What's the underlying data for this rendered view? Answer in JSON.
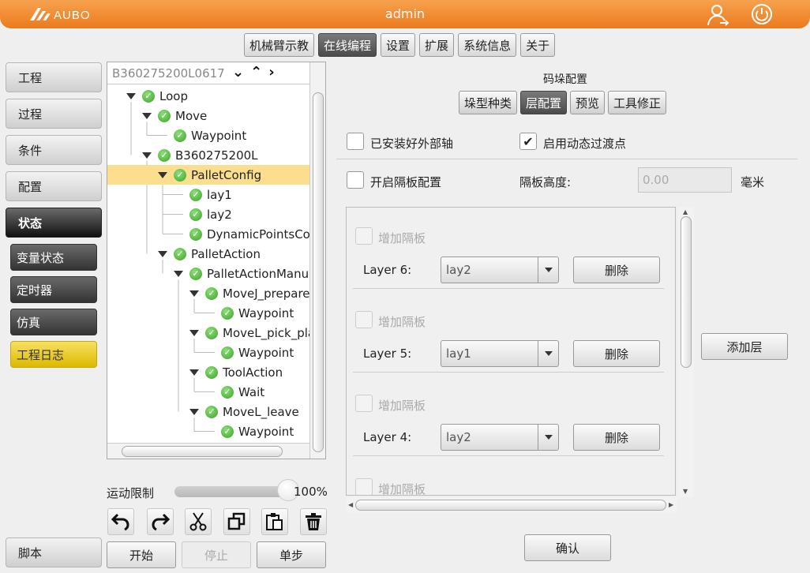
{
  "header": {
    "logo_text": "AUBO",
    "title": "admin",
    "user_icon": "user-logout-icon",
    "power_icon": "power-icon"
  },
  "top_tabs": [
    {
      "label": "机械臂示教",
      "active": false
    },
    {
      "label": "在线编程",
      "active": true
    },
    {
      "label": "设置",
      "active": false
    },
    {
      "label": "扩展",
      "active": false
    },
    {
      "label": "系统信息",
      "active": false
    },
    {
      "label": "关于",
      "active": false
    }
  ],
  "nav": {
    "project": "工程",
    "process": "过程",
    "condition": "条件",
    "config": "配置",
    "status": "状态",
    "var_status": "变量状态",
    "timer": "定时器",
    "simulation": "仿真",
    "project_log": "工程日志",
    "script": "脚本"
  },
  "tree": {
    "header_text": "B360275200L0617",
    "nodes": [
      {
        "label": "Loop",
        "level": 0,
        "expanded": true
      },
      {
        "label": "Move",
        "level": 1,
        "expanded": true
      },
      {
        "label": "Waypoint",
        "level": 2
      },
      {
        "label": "B360275200L",
        "level": 1,
        "expanded": true
      },
      {
        "label": "PalletConfig",
        "level": 2,
        "expanded": true,
        "selected": true
      },
      {
        "label": "lay1",
        "level": 3
      },
      {
        "label": "lay2",
        "level": 3
      },
      {
        "label": "DynamicPointsCon",
        "level": 3
      },
      {
        "label": "PalletAction",
        "level": 2,
        "expanded": true
      },
      {
        "label": "PalletActionManua",
        "level": 3,
        "expanded": true
      },
      {
        "label": "MoveJ_prepare",
        "level": 4,
        "expanded": true
      },
      {
        "label": "Waypoint",
        "level": 5
      },
      {
        "label": "MoveL_pick_pla",
        "level": 4,
        "expanded": true
      },
      {
        "label": "Waypoint",
        "level": 5
      },
      {
        "label": "ToolAction",
        "level": 4,
        "expanded": true
      },
      {
        "label": "Wait",
        "level": 5
      },
      {
        "label": "MoveL_leave",
        "level": 4,
        "expanded": true
      },
      {
        "label": "Waypoint",
        "level": 5
      }
    ]
  },
  "motion": {
    "label": "运动限制",
    "value_text": "100%",
    "fraction": 1.0
  },
  "run": {
    "start": "开始",
    "stop": "停止",
    "step": "单步"
  },
  "pallet": {
    "title": "码垛配置",
    "subtabs": [
      {
        "label": "垛型种类",
        "active": false
      },
      {
        "label": "层配置",
        "active": true
      },
      {
        "label": "预览",
        "active": false
      },
      {
        "label": "工具修正",
        "active": false
      }
    ],
    "external_axis_label": "已安装好外部轴",
    "external_axis_checked": false,
    "dynamic_transition_label": "启用动态过渡点",
    "dynamic_transition_checked": true,
    "partition_label": "开启隔板配置",
    "partition_checked": false,
    "partition_height_label": "隔板高度:",
    "partition_height_value": "0.00",
    "unit": "毫米",
    "add_partition_label": "增加隔板",
    "delete_label": "删除",
    "layers": [
      {
        "label": "Layer 6:",
        "value": "lay2"
      },
      {
        "label": "Layer 5:",
        "value": "lay1"
      },
      {
        "label": "Layer 4:",
        "value": "lay2"
      }
    ],
    "add_layer": "添加层",
    "confirm": "确认"
  }
}
